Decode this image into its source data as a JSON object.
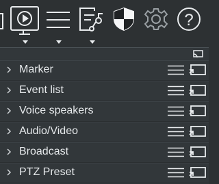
{
  "toolbar": {
    "items": [
      {
        "name": "dock-edge-icon"
      },
      {
        "name": "play-screen-icon",
        "has_dropdown": true
      },
      {
        "name": "list-menu-icon",
        "has_dropdown": true
      },
      {
        "name": "flowchart-icon",
        "has_dropdown": true
      },
      {
        "name": "shield-icon"
      },
      {
        "name": "gear-icon"
      },
      {
        "name": "help-icon",
        "label": "?"
      }
    ]
  },
  "panel": {
    "header_icon": "cast-icon",
    "rows": [
      {
        "label": "Marker"
      },
      {
        "label": "Event list"
      },
      {
        "label": "Voice speakers"
      },
      {
        "label": "Audio/Video"
      },
      {
        "label": "Broadcast"
      },
      {
        "label": "PTZ Preset"
      }
    ]
  },
  "colors": {
    "background": "#2d3133",
    "panel": "#32373a",
    "text": "#e6e9eb",
    "icon": "#e9ecee"
  }
}
